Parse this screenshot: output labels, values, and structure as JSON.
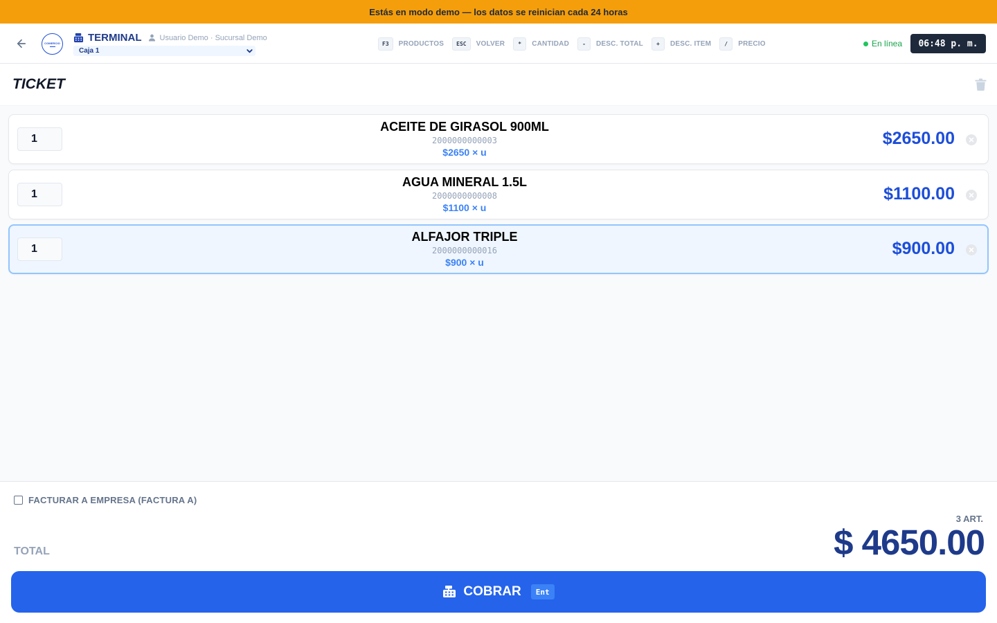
{
  "banner": {
    "text": "Estás en modo demo — los datos se reinician cada 24 horas"
  },
  "header": {
    "logo_text": "COMERCIO",
    "title": "TERMINAL",
    "user_info": "Usuario Demo · Sucursal Demo",
    "caja_selected": "Caja 1",
    "shortcuts": [
      {
        "key": "F3",
        "label": "PRODUCTOS"
      },
      {
        "key": "ESC",
        "label": "VOLVER"
      },
      {
        "key": "*",
        "label": "CANTIDAD"
      },
      {
        "key": "-",
        "label": "DESC. TOTAL"
      },
      {
        "key": "+",
        "label": "DESC. ITEM"
      },
      {
        "key": "/",
        "label": "PRECIO"
      }
    ],
    "status": "En línea",
    "clock": "06:48 p. m."
  },
  "ticket": {
    "title": "TICKET",
    "items": [
      {
        "qty": "1",
        "name": "ACEITE DE GIRASOL 900ML",
        "code": "2000000000003",
        "unit_price": "$2650 × u",
        "total": "$2650.00"
      },
      {
        "qty": "1",
        "name": "AGUA MINERAL 1.5L",
        "code": "2000000000008",
        "unit_price": "$1100 × u",
        "total": "$1100.00"
      },
      {
        "qty": "1",
        "name": "ALFAJOR TRIPLE",
        "code": "2000000000016",
        "unit_price": "$900 × u",
        "total": "$900.00"
      }
    ]
  },
  "footer": {
    "factura_label": "FACTURAR A EMPRESA (FACTURA A)",
    "total_label": "TOTAL",
    "art_count": "3 ART.",
    "total_value": "$ 4650.00",
    "cobrar_label": "COBRAR",
    "cobrar_key": "Ent"
  },
  "colors": {
    "banner": "#f59e0b",
    "accent": "#2563eb",
    "price": "#1d4ed8",
    "online": "#22c55e",
    "selected_row": "#eff6ff"
  }
}
